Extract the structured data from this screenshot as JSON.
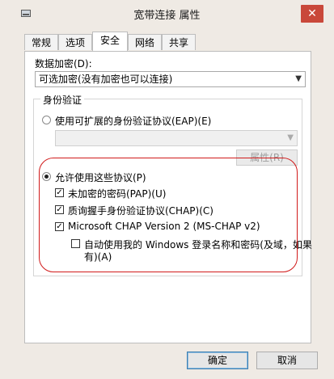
{
  "window": {
    "title": "宽带连接 属性",
    "close_glyph": "✕"
  },
  "tabs": [
    {
      "label": "常规",
      "active": false
    },
    {
      "label": "选项",
      "active": false
    },
    {
      "label": "安全",
      "active": true
    },
    {
      "label": "网络",
      "active": false
    },
    {
      "label": "共享",
      "active": false
    }
  ],
  "security": {
    "encryption_label": "数据加密(D):",
    "encryption_value": "可选加密(没有加密也可以连接)",
    "auth_group_title": "身份验证",
    "eap_radio_label": "使用可扩展的身份验证协议(EAP)(E)",
    "eap_select_value": "",
    "properties_button": "属性(R)",
    "allow_protocols_label": "允许使用这些协议(P)",
    "protocols": [
      {
        "label": "未加密的密码(PAP)(U)",
        "checked": true
      },
      {
        "label": "质询握手身份验证协议(CHAP)(C)",
        "checked": true
      },
      {
        "label": "Microsoft CHAP Version 2 (MS-CHAP v2)",
        "checked": true
      }
    ],
    "auto_logon_line1": "自动使用我的 Windows 登录名称和密码(及域，如果",
    "auto_logon_line2": "有)(A)",
    "auto_logon_checked": false
  },
  "footer": {
    "ok_label": "确定",
    "cancel_label": "取消"
  },
  "colors": {
    "highlight_ring": "#d11a1a",
    "close_button": "#c9483a"
  }
}
